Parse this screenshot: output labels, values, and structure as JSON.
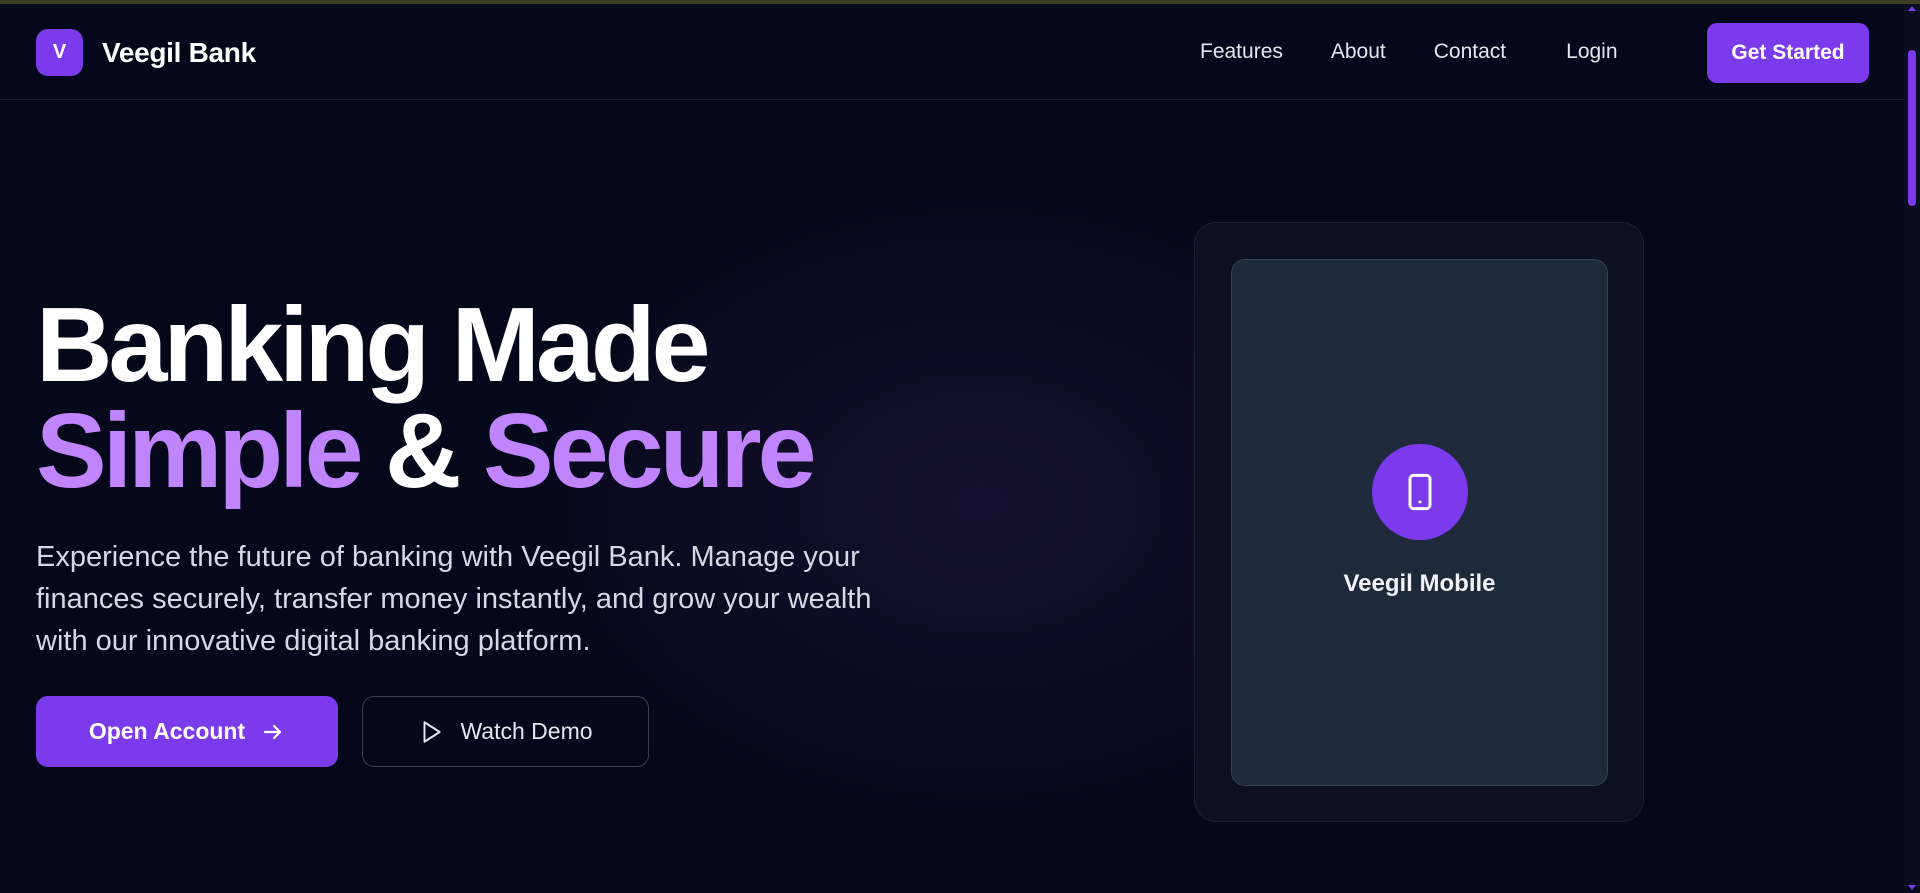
{
  "brand": {
    "logo_letter": "V",
    "name": "Veegil Bank"
  },
  "nav": {
    "links": [
      "Features",
      "About",
      "Contact"
    ],
    "login": "Login",
    "cta": "Get Started"
  },
  "hero": {
    "title_line1": "Banking Made",
    "title_line2_part1": "Simple",
    "title_line2_amp": " & ",
    "title_line2_part2": "Secure",
    "subtitle": "Experience the future of banking with Veegil Bank. Manage your finances securely, transfer money instantly, and grow your wealth with our innovative digital banking platform.",
    "primary_button": "Open Account",
    "secondary_button": "Watch Demo"
  },
  "mockup": {
    "icon": "smartphone-icon",
    "label": "Veegil Mobile"
  },
  "colors": {
    "background": "#05071a",
    "accent": "#7c3aed",
    "accent_light": "#c084fc",
    "card": "#1e293b"
  }
}
